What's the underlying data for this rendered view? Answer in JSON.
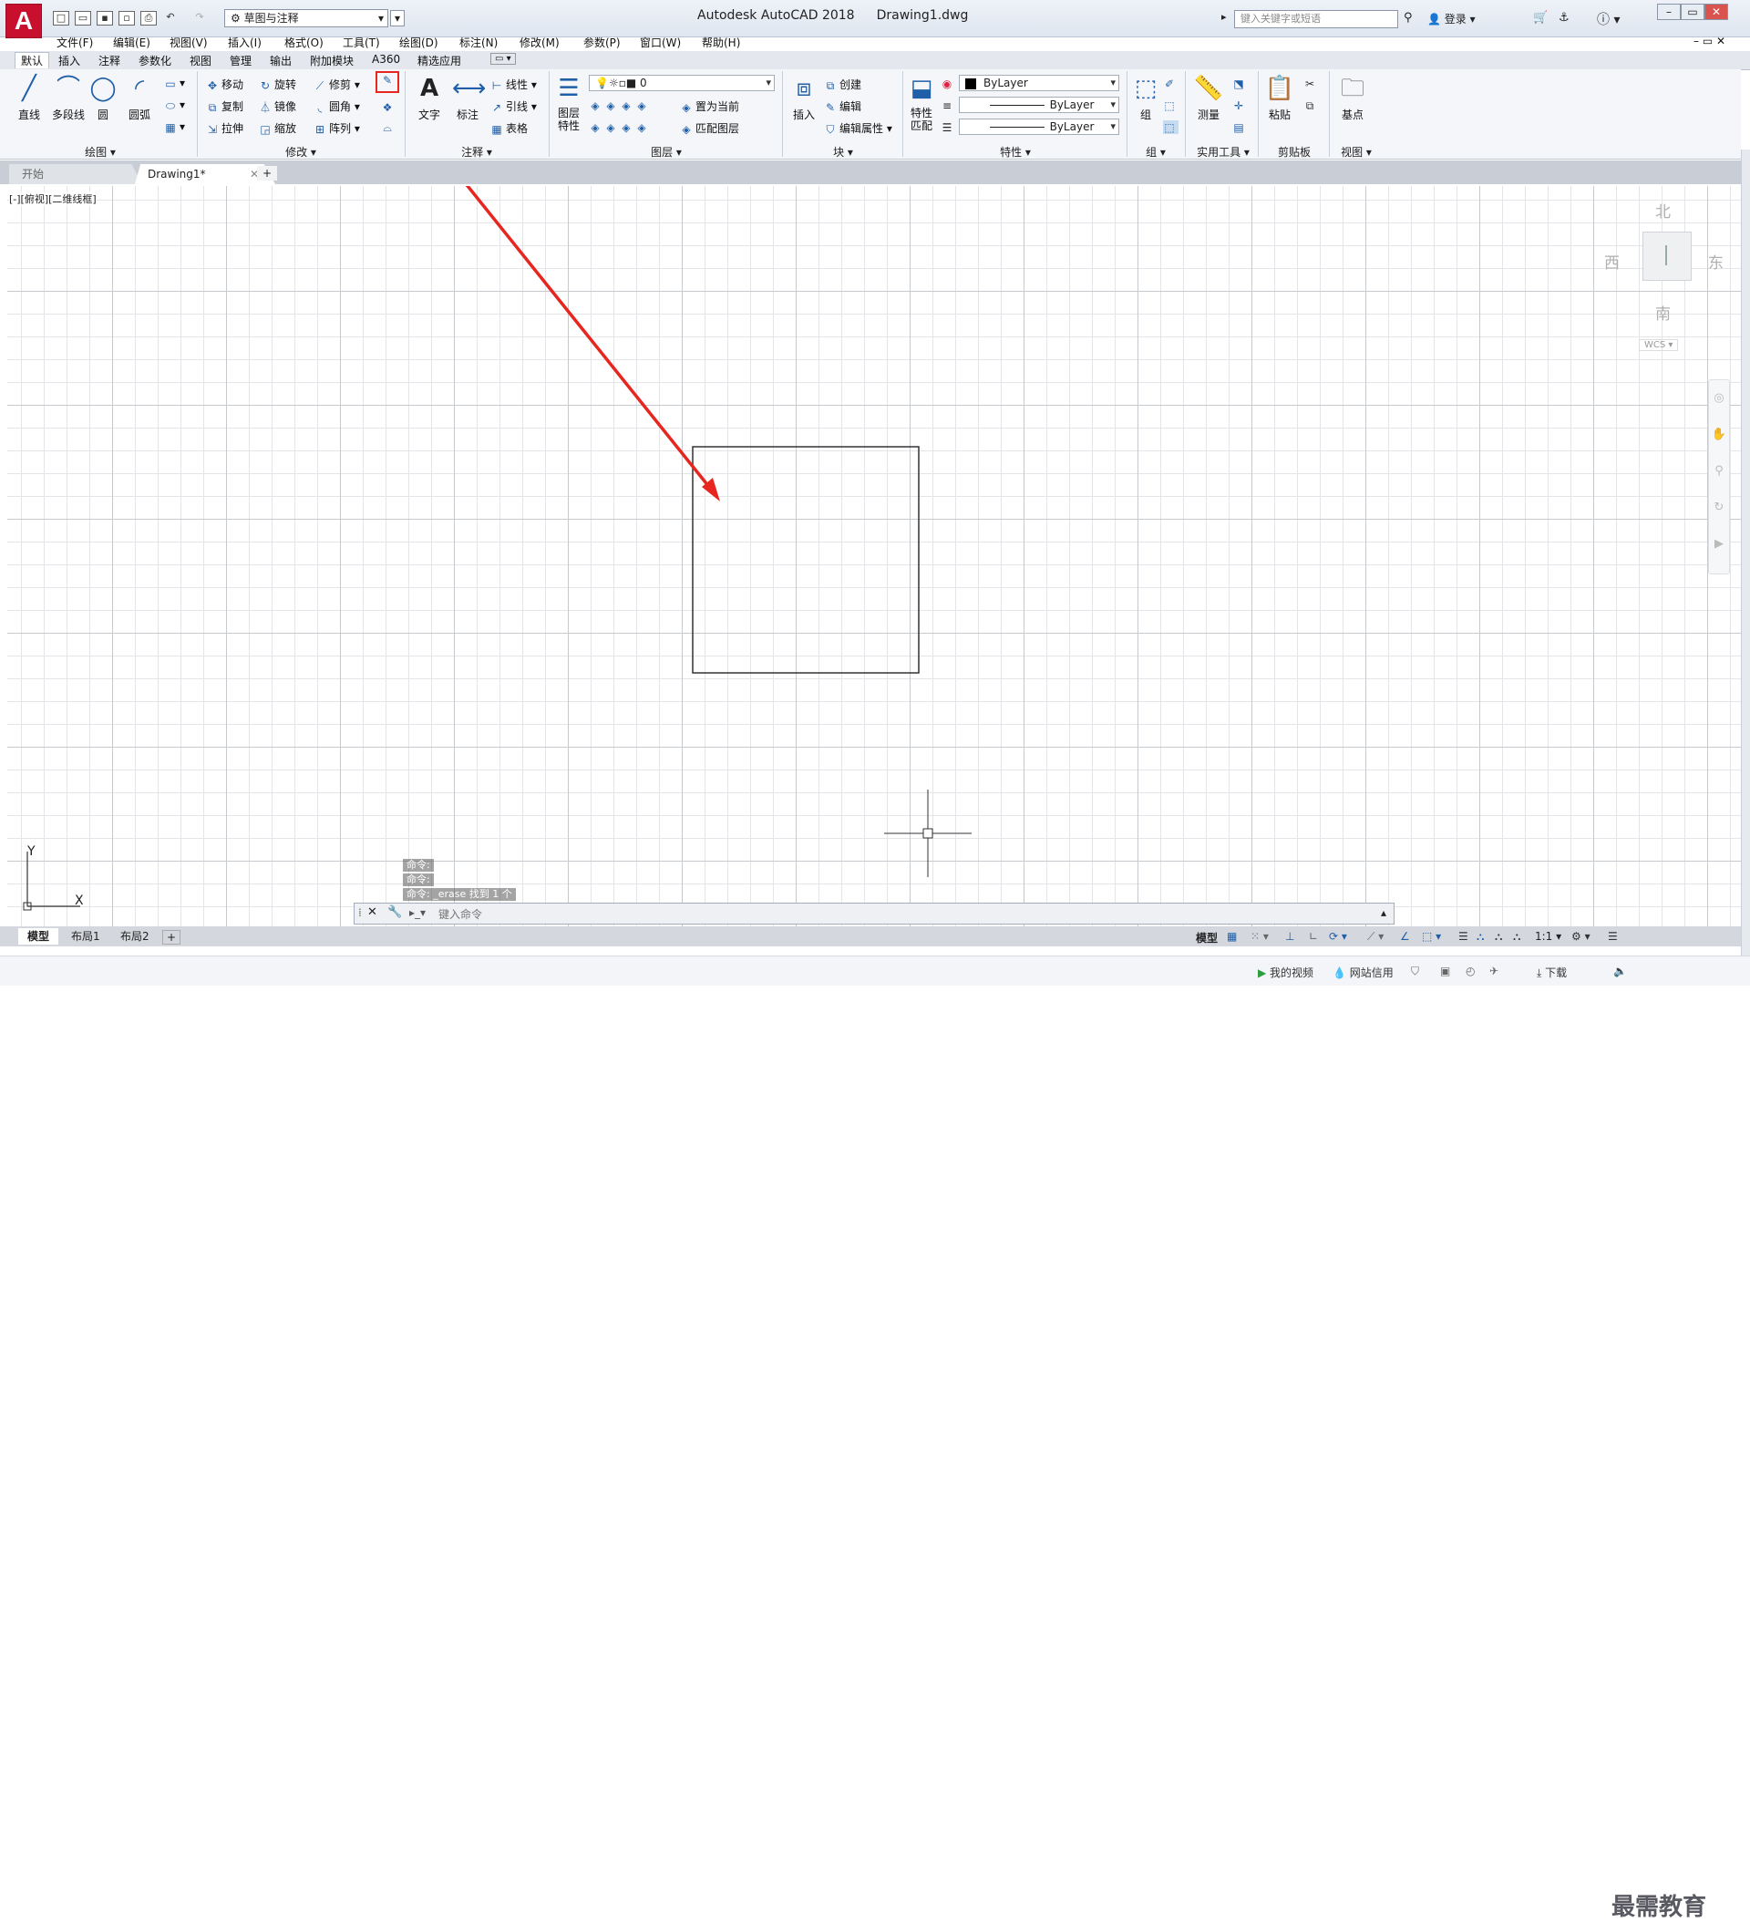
{
  "titlebar": {
    "app_name": "Autodesk AutoCAD 2018",
    "file_name": "Drawing1.dwg",
    "workspace": "草图与注释",
    "search_placeholder": "键入关键字或短语",
    "login": "登录",
    "logo": "A"
  },
  "menu": [
    "文件(F)",
    "编辑(E)",
    "视图(V)",
    "插入(I)",
    "格式(O)",
    "工具(T)",
    "绘图(D)",
    "标注(N)",
    "修改(M)",
    "参数(P)",
    "窗口(W)",
    "帮助(H)"
  ],
  "ribbon_tabs": [
    "默认",
    "插入",
    "注释",
    "参数化",
    "视图",
    "管理",
    "输出",
    "附加模块",
    "A360",
    "精选应用"
  ],
  "ribbon": {
    "draw": {
      "label": "绘图",
      "line": "直线",
      "polyline": "多段线",
      "circle": "圆",
      "arc": "圆弧"
    },
    "modify": {
      "label": "修改",
      "move": "移动",
      "rotate": "旋转",
      "trim": "修剪",
      "copy": "复制",
      "mirror": "镜像",
      "fillet": "圆角",
      "stretch": "拉伸",
      "scale": "缩放",
      "array": "阵列"
    },
    "annotation": {
      "label": "注释",
      "text": "文字",
      "dimension": "标注",
      "linear": "线性",
      "leader": "引线",
      "table": "表格"
    },
    "layers": {
      "label": "图层",
      "layer_props": "图层\n特性",
      "layer_value": "0",
      "set_current": "置为当前",
      "match_layer": "匹配图层"
    },
    "block": {
      "label": "块",
      "insert": "插入",
      "create": "创建",
      "edit": "编辑",
      "edit_attr": "编辑属性"
    },
    "properties": {
      "label": "特性",
      "match": "特性\n匹配",
      "color": "ByLayer",
      "linetype": "ByLayer",
      "lineweight": "ByLayer"
    },
    "groups": {
      "label": "组",
      "group": "组"
    },
    "utilities": {
      "label": "实用工具",
      "measure": "测量"
    },
    "clipboard": {
      "label": "剪贴板",
      "paste": "粘贴"
    },
    "view": {
      "label": "视图",
      "base": "基点"
    }
  },
  "file_tabs": {
    "start": "开始",
    "drawing": "Drawing1*"
  },
  "viewport_label": "[-][俯视][二维线框]",
  "viewcube": {
    "north": "北",
    "south": "南",
    "east": "东",
    "west": "西",
    "wcs": "WCS"
  },
  "ucs": {
    "x": "X",
    "y": "Y"
  },
  "command": {
    "history": [
      "命令:",
      "命令:",
      "命令: _erase 找到 1 个"
    ],
    "placeholder": "键入命令"
  },
  "layout_tabs": [
    "模型",
    "布局1",
    "布局2"
  ],
  "status": {
    "model": "模型",
    "scale": "1:1"
  },
  "footer": {
    "my_video": "我的视频",
    "site_credit": "网站信用",
    "download": "下载",
    "watermark": "最需教育"
  },
  "colors": {
    "accent_red": "#e6261f",
    "app_red": "#c8102e",
    "ribbon_blue": "#1f5fa8"
  }
}
